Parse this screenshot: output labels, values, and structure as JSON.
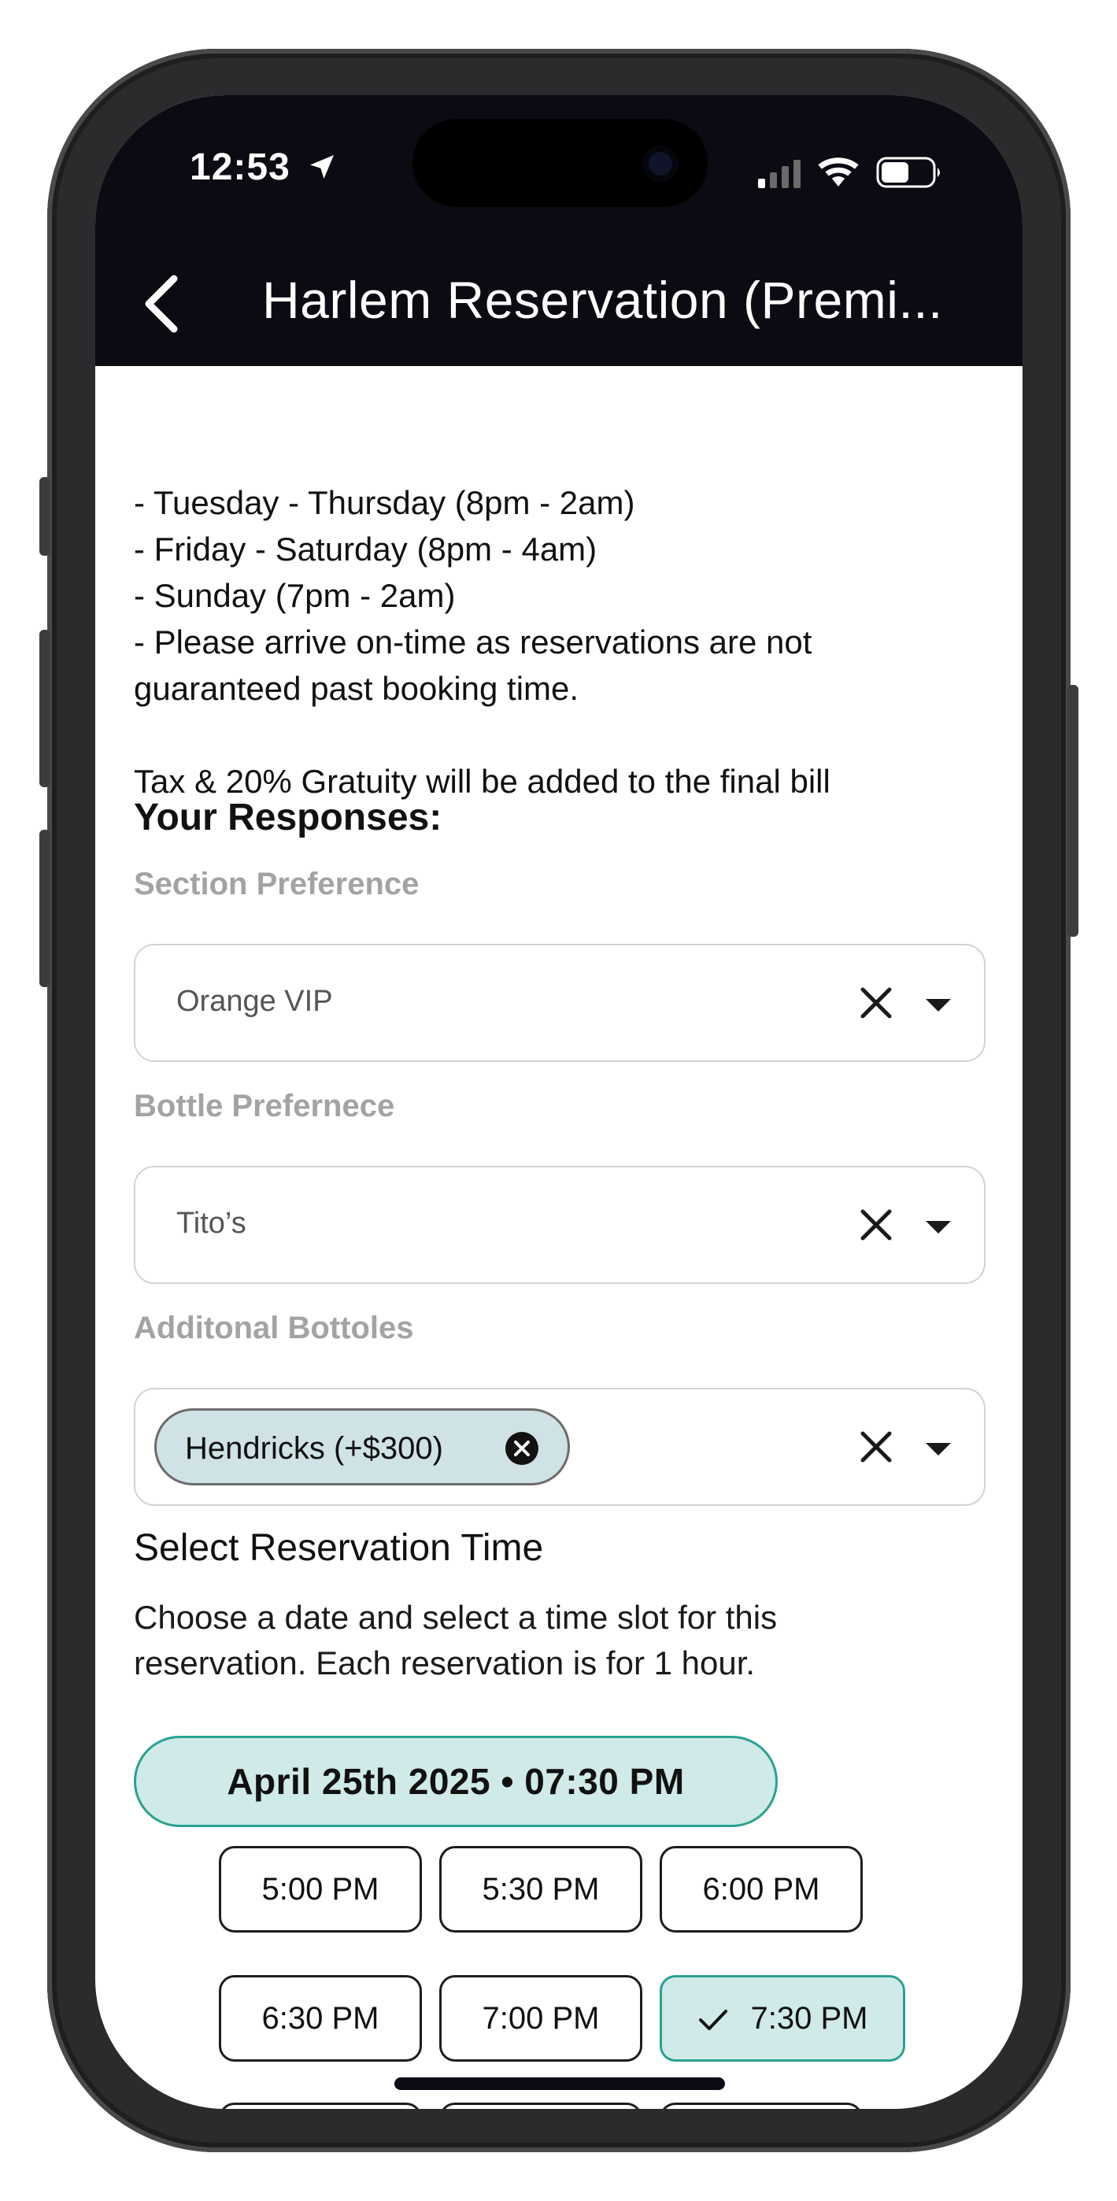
{
  "status_bar": {
    "time": "12:53",
    "icons": [
      "location-arrow-icon",
      "cellular-signal-icon",
      "wifi-icon",
      "battery-icon"
    ]
  },
  "nav": {
    "back_icon": "chevron-left-icon",
    "title": "Harlem Reservation (Premi..."
  },
  "description": {
    "lines": [
      "- Tuesday - Thursday (8pm - 2am)",
      "- Friday - Saturday (8pm - 4am)",
      "- Sunday (7pm - 2am)",
      "- Please arrive on-time as reservations are not",
      "guaranteed past booking time.",
      "Tax & 20% Gratuity will be added to the final bill"
    ]
  },
  "responses": {
    "heading": "Your Responses:",
    "fields": [
      {
        "label": "Section Preference",
        "value": "Orange VIP"
      },
      {
        "label": "Bottle Prefernece",
        "value": "Tito’s"
      },
      {
        "label": "Additonal Bottoles",
        "chips": [
          "Hendricks (+$300)"
        ]
      }
    ]
  },
  "reservation": {
    "title": "Select Reservation Time",
    "description_lines": [
      "Choose a date and select a time slot for this",
      "reservation. Each reservation is for 1 hour."
    ],
    "selected_datetime": "April 25th 2025 • 07:30 PM",
    "time_slots": [
      "5:00 PM",
      "5:30 PM",
      "6:00 PM",
      "6:30 PM",
      "7:00 PM",
      "7:30 PM"
    ],
    "selected_slot": "7:30 PM"
  },
  "colors": {
    "header_bg": "#0c0b13",
    "accent": "#2aa190",
    "accent_light": "#cfeae8",
    "chip_bg": "#cfe2e6",
    "label_gray": "#a3a3a3"
  }
}
